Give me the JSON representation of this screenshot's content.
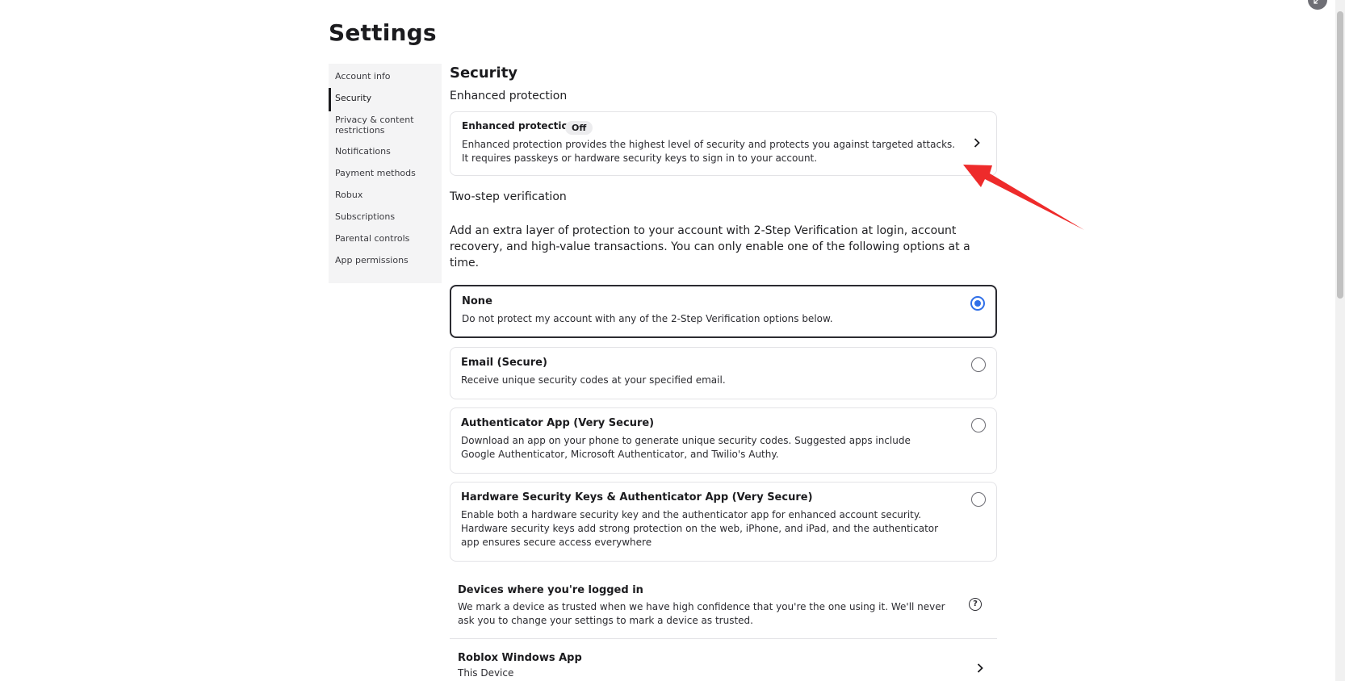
{
  "page": {
    "title": "Settings"
  },
  "sidebar": {
    "items": [
      {
        "label": "Account info"
      },
      {
        "label": "Security",
        "active": true
      },
      {
        "label": "Privacy & content restrictions"
      },
      {
        "label": "Notifications"
      },
      {
        "label": "Payment methods"
      },
      {
        "label": "Robux"
      },
      {
        "label": "Subscriptions"
      },
      {
        "label": "Parental controls"
      },
      {
        "label": "App permissions"
      }
    ]
  },
  "security": {
    "title": "Security",
    "enhanced": {
      "heading": "Enhanced protection",
      "card_title": "Enhanced protection",
      "status": "Off",
      "description": "Enhanced protection provides the highest level of security and protects you against targeted attacks. It requires passkeys or hardware security keys to sign in to your account.",
      "icon": "chevron-right-icon"
    },
    "two_step": {
      "heading": "Two-step verification",
      "intro": "Add an extra layer of protection to your account with 2-Step Verification at login, account recovery, and high-value transactions. You can only enable one of the following options at a time.",
      "options": [
        {
          "title": "None",
          "description": "Do not protect my account with any of the 2-Step Verification options below.",
          "selected": true
        },
        {
          "title": "Email (Secure)",
          "description": "Receive unique security codes at your specified email.",
          "selected": false
        },
        {
          "title": "Authenticator App (Very Secure)",
          "description": "Download an app on your phone to generate unique security codes. Suggested apps include Google Authenticator, Microsoft Authenticator, and Twilio's Authy.",
          "selected": false
        },
        {
          "title": "Hardware Security Keys & Authenticator App (Very Secure)",
          "description": "Enable both a hardware security key and the authenticator app for enhanced account security. Hardware security keys add strong protection on the web, iPhone, and iPad, and the authenticator app ensures secure access everywhere",
          "selected": false
        }
      ]
    },
    "devices": {
      "title": "Devices where you're logged in",
      "description": "We mark a device as trusted when we have high confidence that you're the one using it. We'll never ask you to change your settings to mark a device as trusted.",
      "help_icon": "?",
      "items": [
        {
          "name": "Roblox Windows App",
          "subtitle": "This Device"
        }
      ]
    }
  },
  "colors": {
    "accent": "#2f6fe8",
    "annotation_arrow": "#ee2b2b",
    "text": "#1b1b1e",
    "border": "#e3e3e6",
    "sidebar_bg": "#f4f4f5"
  }
}
